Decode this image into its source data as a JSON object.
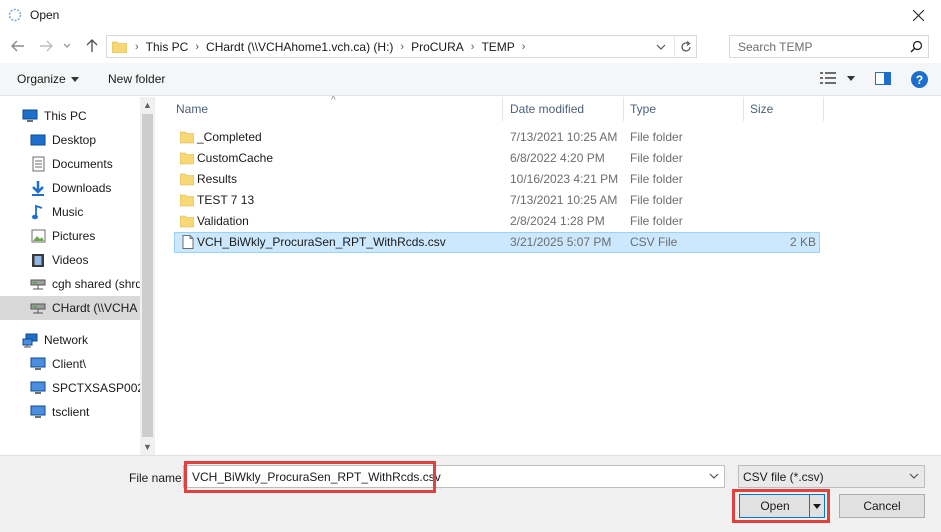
{
  "window": {
    "title": "Open"
  },
  "address": {
    "crumbs": [
      "This PC",
      "CHardt (\\\\VCHAhome1.vch.ca) (H:)",
      "ProCURA",
      "TEMP"
    ]
  },
  "search": {
    "placeholder": "Search TEMP"
  },
  "toolbar": {
    "organize": "Organize",
    "new_folder": "New folder"
  },
  "nav": {
    "items": [
      {
        "label": "This PC",
        "icon": "pc-icon"
      },
      {
        "label": "Desktop",
        "icon": "desktop-icon"
      },
      {
        "label": "Documents",
        "icon": "documents-icon"
      },
      {
        "label": "Downloads",
        "icon": "downloads-icon"
      },
      {
        "label": "Music",
        "icon": "music-icon"
      },
      {
        "label": "Pictures",
        "icon": "pictures-icon"
      },
      {
        "label": "Videos",
        "icon": "videos-icon"
      },
      {
        "label": "cgh shared (shrd",
        "icon": "network-drive-icon"
      },
      {
        "label": "CHardt (\\\\VCHA",
        "icon": "network-drive-icon"
      },
      {
        "label": "Network",
        "icon": "network-icon"
      },
      {
        "label": "Client\\",
        "icon": "computer-icon"
      },
      {
        "label": "SPCTXSASP002",
        "icon": "computer-icon"
      },
      {
        "label": "tsclient",
        "icon": "computer-icon"
      }
    ]
  },
  "columns": {
    "name": "Name",
    "date": "Date modified",
    "type": "Type",
    "size": "Size"
  },
  "files": [
    {
      "name": "_Completed",
      "date": "7/13/2021 10:25 AM",
      "type": "File folder",
      "size": ""
    },
    {
      "name": "CustomCache",
      "date": "6/8/2022 4:20 PM",
      "type": "File folder",
      "size": ""
    },
    {
      "name": "Results",
      "date": "10/16/2023 4:21 PM",
      "type": "File folder",
      "size": ""
    },
    {
      "name": "TEST 7 13",
      "date": "7/13/2021 10:25 AM",
      "type": "File folder",
      "size": ""
    },
    {
      "name": "Validation",
      "date": "2/8/2024 1:28 PM",
      "type": "File folder",
      "size": ""
    },
    {
      "name": "VCH_BiWkly_ProcuraSen_RPT_WithRcds.csv",
      "date": "3/21/2025 5:07 PM",
      "type": "CSV File",
      "size": "2 KB"
    }
  ],
  "bottom": {
    "file_name_label": "File name:",
    "file_name_value": "VCH_BiWkly_ProcuraSen_RPT_WithRcds.csv",
    "filter": "CSV file (*.csv)",
    "open": "Open",
    "cancel": "Cancel"
  },
  "colors": {
    "accent": "#0078d7",
    "highlight_box": "#e0403e",
    "selection": "#cce8ff",
    "folder": "#f8d775"
  }
}
